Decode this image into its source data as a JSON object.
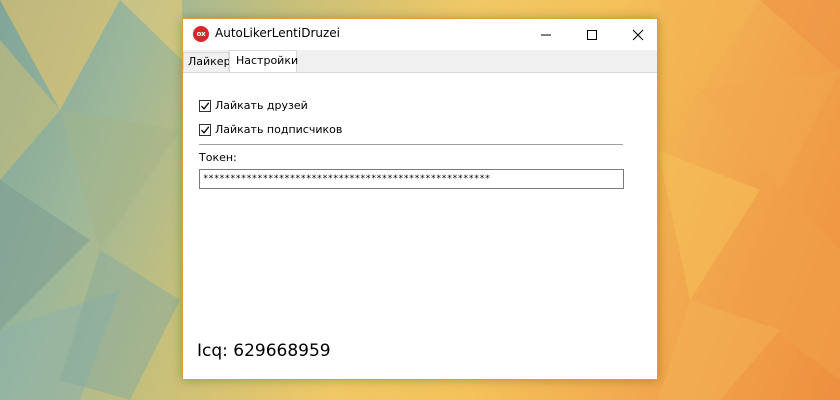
{
  "window": {
    "title": "AutoLikerLentiDruzei",
    "icon_text": "ox"
  },
  "tabs": [
    {
      "label": "Лайкер",
      "active": false
    },
    {
      "label": "Настройки",
      "active": true
    }
  ],
  "settings": {
    "like_friends": {
      "label": "Лайкать друзей",
      "checked": true
    },
    "like_subscribers": {
      "label": "Лайкать подписчиков",
      "checked": true
    },
    "token_label": "Токен:",
    "token_value": "*****************************************************"
  },
  "footer": {
    "icq_text": "Icq: 629668959"
  },
  "colors": {
    "icon_red": "#d9262a",
    "window_border": "#d8a33a"
  }
}
